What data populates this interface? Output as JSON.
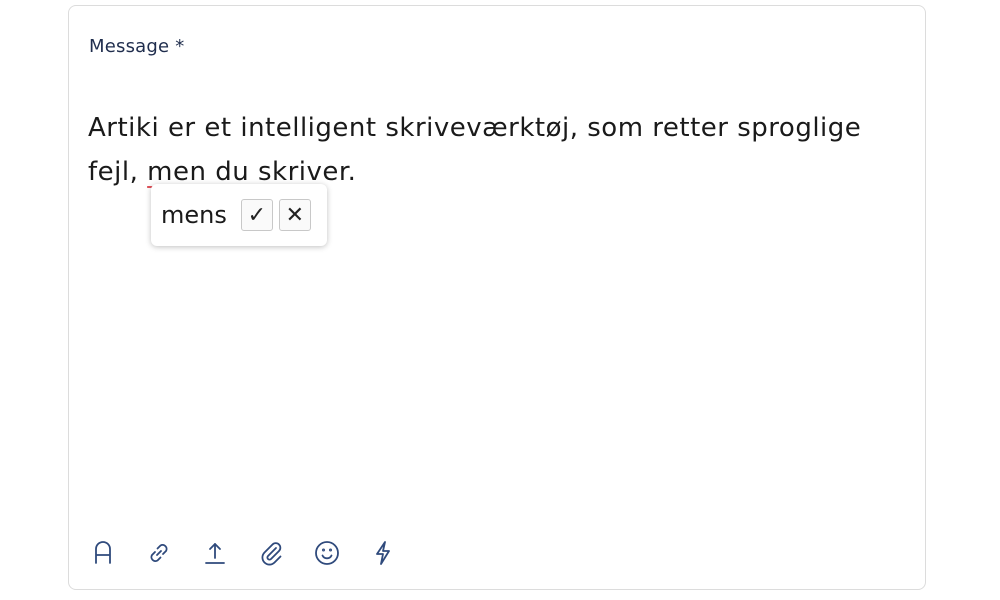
{
  "field": {
    "label": "Message *"
  },
  "message": {
    "before": "Artiki er et intelligent skriveværktøj, som retter sproglige fejl, ",
    "flagged_word": "men",
    "after": " du skriver."
  },
  "suggestion": {
    "word": "mens",
    "accept_glyph": "✓",
    "reject_glyph": "✕"
  },
  "toolbar": {
    "icons": [
      "format-text-icon",
      "link-icon",
      "upload-icon",
      "attachment-icon",
      "emoji-icon",
      "lightning-icon"
    ]
  },
  "colors": {
    "icon": "#2f4a7c",
    "label": "#1f2d4d",
    "underline": "#e0535b",
    "border": "#dcdcdc"
  }
}
